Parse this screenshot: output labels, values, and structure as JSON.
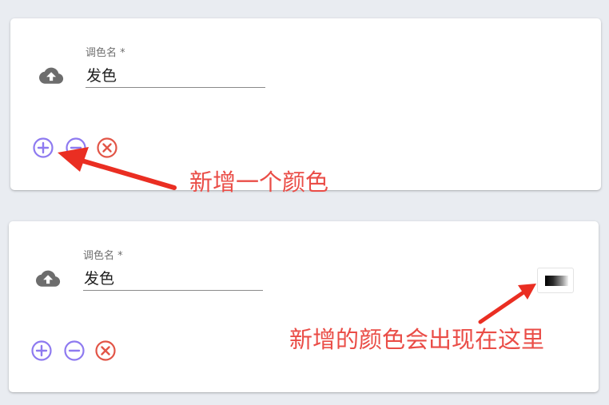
{
  "cards": [
    {
      "field_label": "调色名 *",
      "field_value": "发色",
      "icons": {
        "upload": "cloud-upload-icon",
        "add": "add-circle-icon",
        "remove": "remove-circle-icon",
        "delete": "cancel-circle-icon"
      }
    },
    {
      "field_label": "调色名 *",
      "field_value": "发色",
      "icons": {
        "upload": "cloud-upload-icon",
        "add": "add-circle-icon",
        "remove": "remove-circle-icon",
        "delete": "cancel-circle-icon"
      },
      "swatch": {
        "gradient_from": "#000000",
        "gradient_to": "#f2f2f2"
      }
    }
  ],
  "annotations": {
    "add_color_note": "新增一个颜色",
    "new_color_location_note": "新增的颜色会出现在这里"
  },
  "colors": {
    "background": "#e9ecf1",
    "add_remove_icon": "#8e7af0",
    "delete_icon": "#e25547",
    "annotation": "#ea4d47",
    "upload_icon": "#6d6d6d"
  }
}
